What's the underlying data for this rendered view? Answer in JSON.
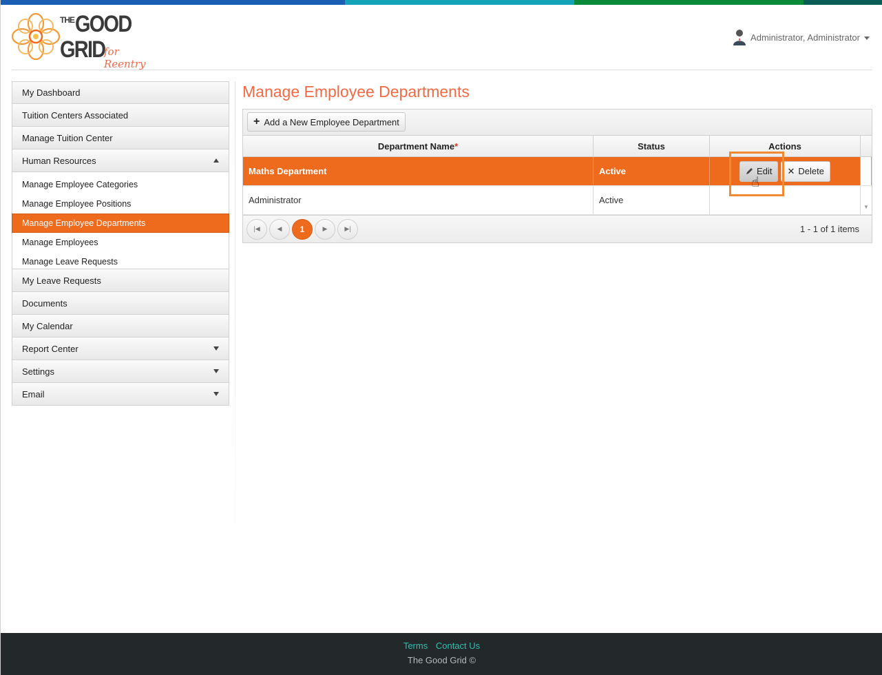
{
  "colors": {
    "stripe": [
      "#1a5fb4",
      "#1478d4",
      "#14a3b8",
      "#0b8a3a",
      "#0a5e55"
    ],
    "accent": "#ee6b1e",
    "title": "#f06a45",
    "footer_bg": "#23282a",
    "footer_link": "#2dc0b0"
  },
  "logo": {
    "the": "THE",
    "good": "GOOD",
    "grid": "GRID",
    "tagline": "for Reentry"
  },
  "user": {
    "name": "Administrator, Administrator",
    "icon": "user-avatar-icon"
  },
  "sidebar": {
    "items_top": [
      {
        "label": "My Dashboard"
      },
      {
        "label": "Tuition Centers Associated"
      },
      {
        "label": "Manage Tuition Center"
      }
    ],
    "hr": {
      "label": "Human Resources",
      "expanded": true
    },
    "sub": [
      {
        "label": "Manage Employee Categories"
      },
      {
        "label": "Manage Employee Positions"
      },
      {
        "label": "Manage Employee Departments",
        "active": true
      },
      {
        "label": "Manage Employees"
      },
      {
        "label": "Manage Leave Requests"
      }
    ],
    "items_bottom": [
      {
        "label": "My Leave Requests",
        "arrow": false
      },
      {
        "label": "Documents",
        "arrow": false
      },
      {
        "label": "My Calendar",
        "arrow": false
      },
      {
        "label": "Report Center",
        "arrow": true
      },
      {
        "label": "Settings",
        "arrow": true
      },
      {
        "label": "Email",
        "arrow": true
      }
    ]
  },
  "main": {
    "title": "Manage Employee Departments",
    "add_button": "Add a New Employee Department",
    "columns": {
      "name": "Department Name",
      "required_mark": "*",
      "status": "Status",
      "actions": "Actions"
    },
    "rows": [
      {
        "name": "Maths Department",
        "status": "Active",
        "selected": true,
        "edit": "Edit",
        "delete": "Delete"
      },
      {
        "name": "Administrator",
        "status": "Active",
        "selected": false
      }
    ],
    "pager": {
      "current": "1",
      "info": "1 - 1 of 1 items"
    }
  },
  "footer": {
    "terms": "Terms",
    "contact": "Contact Us",
    "copyright": "The Good Grid ©"
  }
}
